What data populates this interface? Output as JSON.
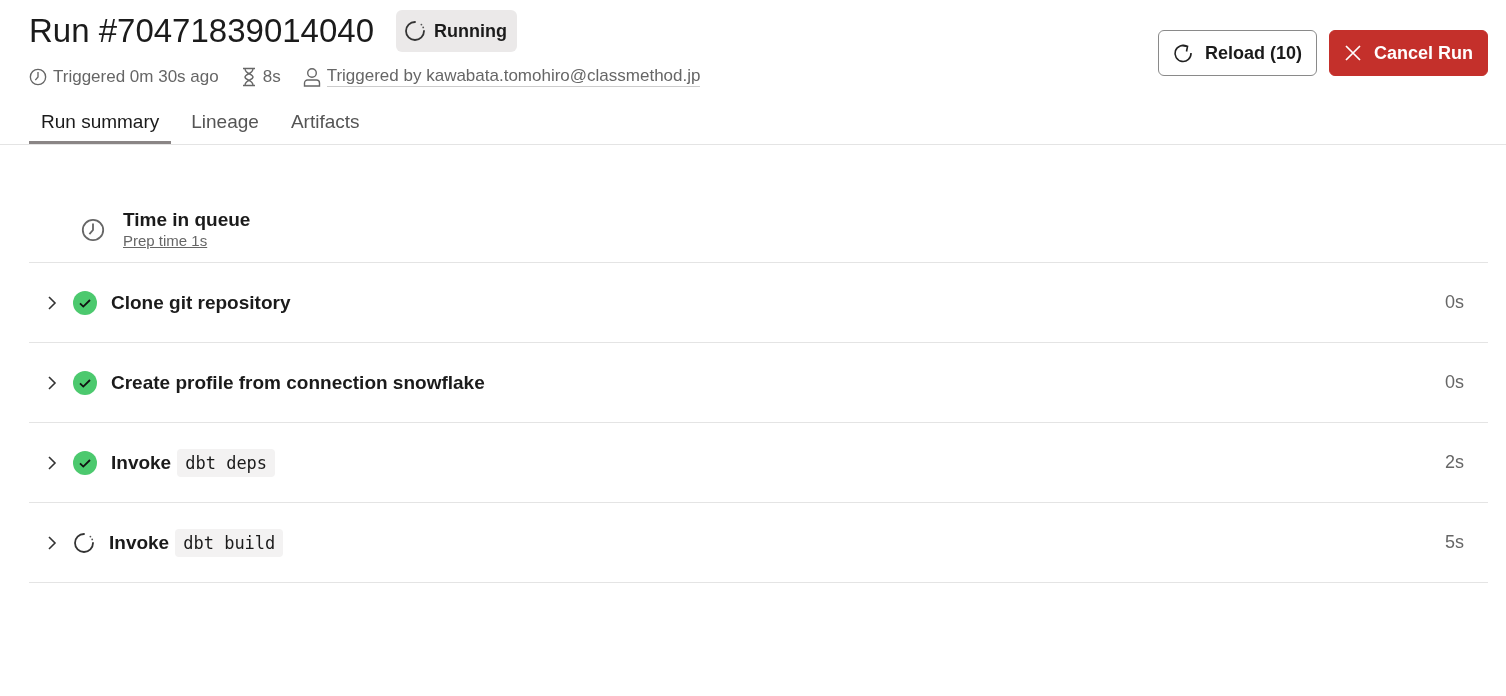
{
  "header": {
    "title": "Run #70471839014040",
    "status_badge": "Running",
    "meta": [
      {
        "kind": "clock",
        "text": "Triggered 0m 30s ago"
      },
      {
        "kind": "hourglass",
        "text": "8s"
      },
      {
        "kind": "person",
        "text": "Triggered by kawabata.tomohiro@classmethod.jp"
      }
    ],
    "buttons": [
      {
        "kind": "reload",
        "label": "Reload (10)"
      },
      {
        "kind": "cancel",
        "label": "Cancel Run"
      }
    ]
  },
  "tabs": [
    {
      "label": "Run summary",
      "selected": true
    },
    {
      "label": "Lineage",
      "selected": false
    },
    {
      "label": "Artifacts",
      "selected": false
    }
  ],
  "queue": {
    "title": "Time in queue",
    "link": "Prep time 1s"
  },
  "steps": [
    {
      "kind": "success",
      "label": "Clone git repository",
      "duration": "0s",
      "expanded": false
    },
    {
      "kind": "success",
      "label": "Create profile from connection snowflake",
      "duration": "0s",
      "expanded": false
    },
    {
      "kind": "success",
      "label": "Invoke",
      "code": "dbt deps",
      "duration": "2s",
      "expanded": false
    },
    {
      "kind": "running",
      "label": "Invoke",
      "code": "dbt build",
      "duration": "5s",
      "expanded": false
    }
  ]
}
